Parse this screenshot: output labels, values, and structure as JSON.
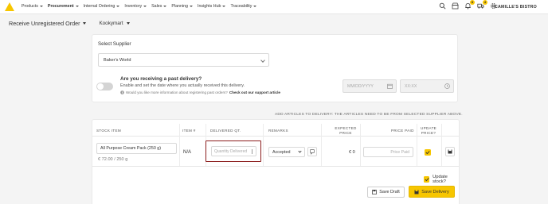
{
  "nav": {
    "items": [
      {
        "label": "Products",
        "active": false
      },
      {
        "label": "Procurement",
        "active": true
      },
      {
        "label": "Internal Ordering",
        "active": false
      },
      {
        "label": "Inventory",
        "active": false
      },
      {
        "label": "Sales",
        "active": false
      },
      {
        "label": "Planning",
        "active": false
      },
      {
        "label": "Insights Hub",
        "active": false
      },
      {
        "label": "Traceability",
        "active": false
      }
    ],
    "icons": [
      "search-icon",
      "store-icon",
      "bell-icon",
      "truck-icon",
      "gear-icon"
    ],
    "badges": {
      "bell": "8",
      "truck": "4"
    },
    "account": "CAMILLE'S BISTRO"
  },
  "header": {
    "title": "Receive Unregistered Order",
    "store": "Kookymart"
  },
  "supplier": {
    "label": "Select Supplier",
    "value": "Baker's World"
  },
  "past_delivery": {
    "question": "Are you receiving a past delivery?",
    "description": "Enable and set the date where you actually received this delivery.",
    "info_prefix": "Would you like more information about registering past orders?",
    "info_link": "Check out our support article",
    "date_placeholder": "MM/DD/YYYY",
    "time_placeholder": "XX:XX"
  },
  "articles_note": "ADD ARTICLES TO DELIVERY: THE ARTICLES NEED TO BE FROM SELECTED SUPPLIER ABOVE.",
  "table": {
    "headers": {
      "stock_item": "STOCK ITEM",
      "item_no": "ITEM #",
      "delivered_qt": "DELIVERED QT.",
      "remarks": "REMARKS",
      "expected_1": "EXPECTED",
      "expected_2": "PRICE",
      "price_paid": "PRICE PAID",
      "update_1": "UPDATE",
      "update_2": "PRICE?"
    },
    "row": {
      "stock_item": "All Purpose Cream Pack (250 g)",
      "unit_price": "€ 72.00 / 250 g",
      "item_no": "N/A",
      "qty_placeholder": "Quantity Delivered",
      "remark": "Accepted",
      "expected_price": "€ 0",
      "price_paid_placeholder": "Price Paid",
      "update_price": true
    }
  },
  "footer": {
    "update_stock_label": "Update stock?",
    "update_stock": true,
    "save_draft": "Save Draft",
    "save_delivery": "Save Delivery"
  },
  "colors": {
    "accent": "#f7c600",
    "highlight": "#8b1d1d"
  }
}
